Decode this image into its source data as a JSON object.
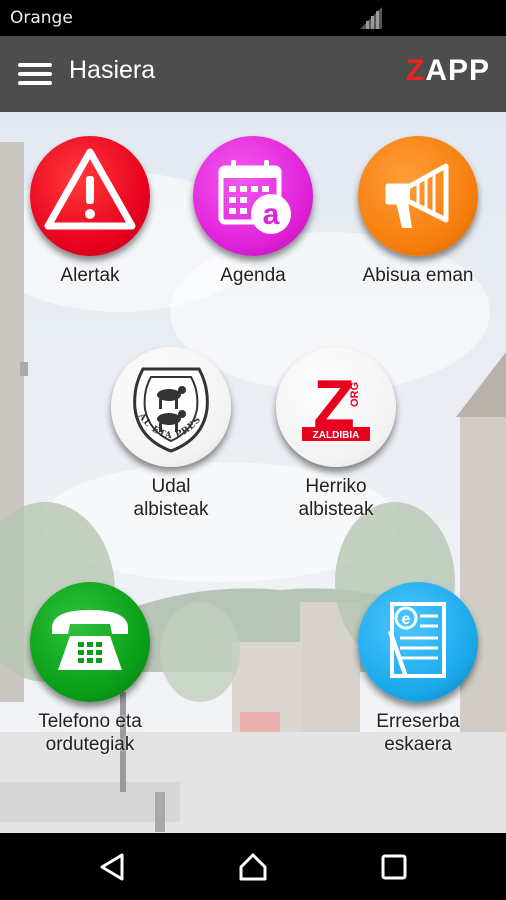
{
  "status_bar": {
    "carrier": "Orange"
  },
  "app_bar": {
    "title": "Hasiera",
    "brand_z": "Z",
    "brand_app": "APP"
  },
  "tiles": [
    {
      "line1": "Alertak",
      "line2": "",
      "icon": "warning-icon"
    },
    {
      "line1": "Agenda",
      "line2": "",
      "icon": "calendar-icon"
    },
    {
      "line1": "Abisua eman",
      "line2": "",
      "icon": "megaphone-icon"
    },
    {
      "line1": "Udal",
      "line2": "albisteak",
      "icon": "town-seal-icon",
      "seal_text": "LEIAL ETA PRESTUA"
    },
    {
      "line1": "Herriko",
      "line2": "albisteak",
      "icon": "zaldibia-logo-icon",
      "logo_letter": "Z",
      "logo_org": "ORG",
      "logo_name": "ZALDIBIA"
    },
    {
      "line1": "Telefono eta",
      "line2": "ordutegiak",
      "icon": "telephone-icon"
    },
    {
      "line1": "Erreserba",
      "line2": "eskaera",
      "icon": "document-icon",
      "doc_letter": "e"
    }
  ],
  "colors": {
    "alert_red": "#e8001f",
    "agenda_magenta": "#e020d8",
    "notice_orange": "#f67e0c",
    "phone_green": "#0a9e18",
    "booking_blue": "#1aa8ea",
    "appbar": "#4d4d4d"
  },
  "nav": {
    "back": "back-icon",
    "home": "home-icon",
    "recents": "recents-icon"
  }
}
